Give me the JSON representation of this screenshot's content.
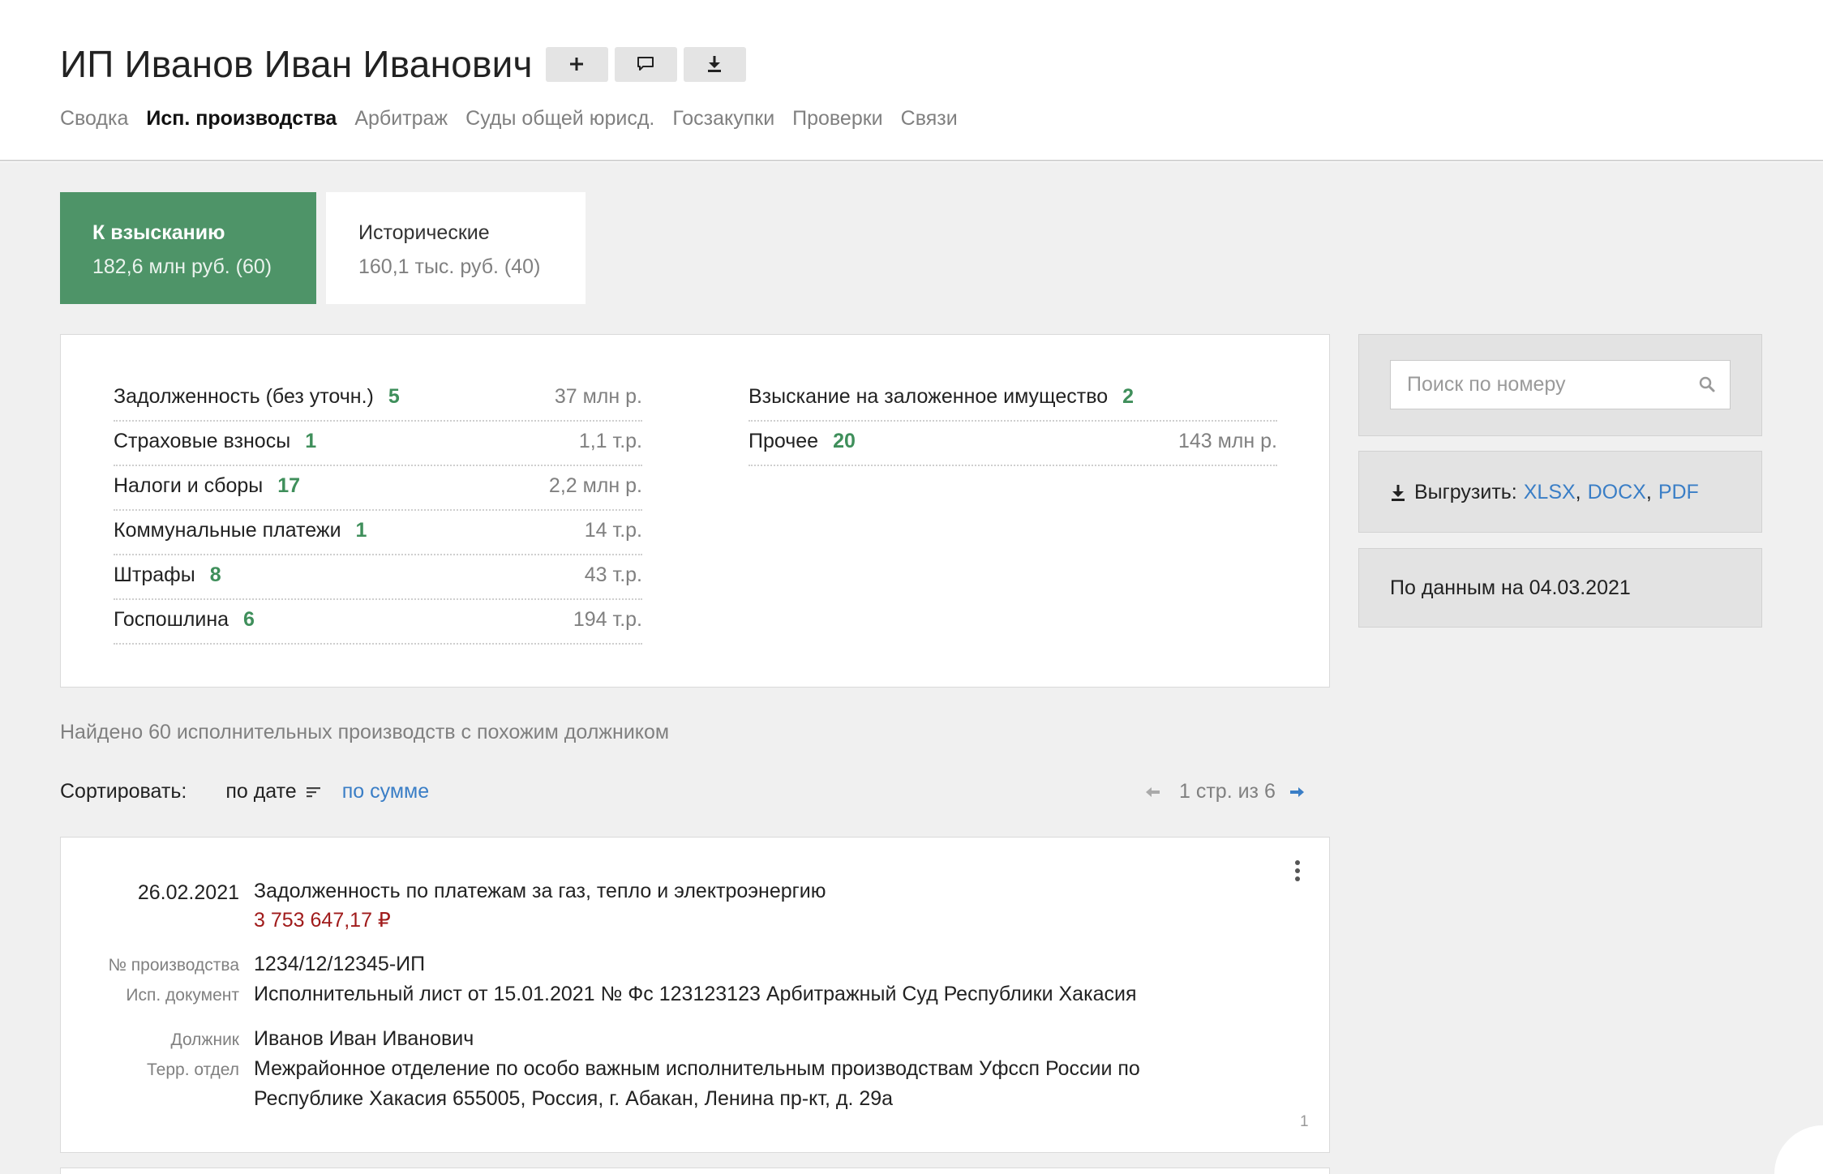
{
  "header": {
    "title": "ИП Иванов Иван Иванович",
    "buttons": [
      {
        "name": "add",
        "icon": "plus-icon"
      },
      {
        "name": "comment",
        "icon": "comment-icon"
      },
      {
        "name": "download",
        "icon": "download-icon"
      }
    ],
    "nav": [
      {
        "label": "Сводка",
        "active": false
      },
      {
        "label": "Исп. производства",
        "active": true
      },
      {
        "label": "Арбитраж",
        "active": false
      },
      {
        "label": "Суды общей юрисд.",
        "active": false
      },
      {
        "label": "Госзакупки",
        "active": false
      },
      {
        "label": "Проверки",
        "active": false
      },
      {
        "label": "Связи",
        "active": false
      }
    ]
  },
  "tabs": [
    {
      "title": "К взысканию",
      "subtitle": "182,6 млн руб. (60)",
      "active": true
    },
    {
      "title": "Исторические",
      "subtitle": "160,1 тыс. руб. (40)",
      "active": false
    }
  ],
  "summary": {
    "left": [
      {
        "label": "Задолженность (без уточн.)",
        "count": "5",
        "amount": "37 млн р."
      },
      {
        "label": "Страховые взносы",
        "count": "1",
        "amount": "1,1 т.р."
      },
      {
        "label": "Налоги и сборы",
        "count": "17",
        "amount": "2,2 млн р."
      },
      {
        "label": "Коммунальные платежи",
        "count": "1",
        "amount": "14 т.р."
      },
      {
        "label": "Штрафы",
        "count": "8",
        "amount": "43 т.р."
      },
      {
        "label": "Госпошлина",
        "count": "6",
        "amount": "194 т.р."
      }
    ],
    "right": [
      {
        "label": "Взыскание на заложенное имущество",
        "count": "2",
        "amount": ""
      },
      {
        "label": "Прочее",
        "count": "20",
        "amount": "143 млн р."
      }
    ]
  },
  "sidebar": {
    "search_placeholder": "Поиск по номеру",
    "export_label": "Выгрузить:",
    "export_formats": [
      "XLSX",
      "DOCX",
      "PDF"
    ],
    "date_text": "По данным на 04.03.2021"
  },
  "found_text": "Найдено 60 исполнительных производств с похожим должником",
  "sort": {
    "label": "Сортировать:",
    "by_date": "по дате",
    "by_sum": "по сумме"
  },
  "pager": {
    "text": "1 стр. из 6"
  },
  "cases": [
    {
      "date": "26.02.2021",
      "subject": "Задолженность по платежам за газ, тепло и электроэнергию",
      "amount": "3 753 647,17 ₽",
      "number_label": "№ производства",
      "number": "1234/12/12345-ИП",
      "doc_label": "Исп. документ",
      "doc": "Исполнительный лист от 15.01.2021 № Фс 123123123 Арбитражный Суд Республики Хакасия",
      "debtor_label": "Должник",
      "debtor": "Иванов Иван Иванович",
      "dept_label": "Терр. отдел",
      "dept_line1": "Межрайонное отделение по особо важным исполнительным производствам Уфссп России по",
      "dept_line2": "Республике Хакасия 655005, Россия, г. Абакан, Ленина пр-кт, д. 29а",
      "index": "1"
    }
  ],
  "colors": {
    "accent_green": "#4e9468",
    "count_green": "#3f8f5b",
    "link_blue": "#3a7ec6",
    "amount_red": "#a01b1b",
    "bg_gray": "#f0f0f0"
  }
}
